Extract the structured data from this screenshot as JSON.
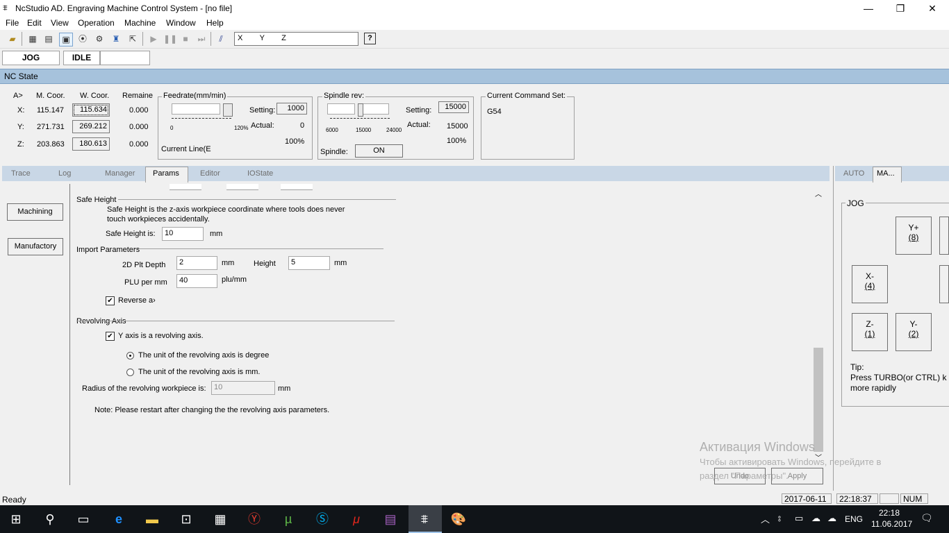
{
  "window": {
    "title": "NcStudio AD. Engraving Machine Control System  - [no file]",
    "minimize": "—",
    "maximize": "❐",
    "close": "✕"
  },
  "menu": [
    "File",
    "Edit",
    "View",
    "Operation",
    "Machine",
    "Window",
    "Help"
  ],
  "toolbar": {
    "command_text": "X        Y        Z",
    "help_icon": "?"
  },
  "status_boxes": {
    "mode": "JOG",
    "state": "IDLE"
  },
  "nc_state": {
    "label": "NC State"
  },
  "coords": {
    "headers": [
      "A>",
      "M. Coor.",
      "W. Coor.",
      "Remaine"
    ],
    "rows": [
      {
        "axis": "X:",
        "m": "115.147",
        "w": "115.634",
        "r": "0.000"
      },
      {
        "axis": "Y:",
        "m": "271.731",
        "w": "269.212",
        "r": "0.000"
      },
      {
        "axis": "Z:",
        "m": "203.863",
        "w": "180.613",
        "r": "0.000"
      }
    ]
  },
  "feedrate": {
    "label": "Feedrate(mm/min)",
    "setting_label": "Setting:",
    "setting": "1000",
    "actual_label": "Actual:",
    "actual": "0",
    "percent": "100%",
    "scale_min": "0",
    "scale_max": "120%",
    "current_line": "Current Line(E"
  },
  "spindle": {
    "label": "Spindle rev:",
    "setting_label": "Setting:",
    "setting": "15000",
    "actual_label": "Actual:",
    "actual": "15000",
    "percent": "100%",
    "ticks": [
      "6000",
      "15000",
      "24000"
    ],
    "spindle_label": "Spindle:",
    "on_button": "ON"
  },
  "command_set": {
    "label": "Current Command Set:",
    "value": "G54"
  },
  "tabs": [
    "Trace",
    "Log",
    "Manager",
    "Params",
    "Editor",
    "IOState"
  ],
  "active_tab": "Params",
  "side_buttons": {
    "machining": "Machining",
    "manufactory": "Manufactory"
  },
  "params": {
    "safe_height": {
      "section": "Safe Height",
      "desc1": "Safe Height is the z-axis workpiece coordinate where tools does never",
      "desc2": "touch workpieces accidentally.",
      "label": "Safe Height is:",
      "value": "10",
      "unit": "mm"
    },
    "import": {
      "section": "Import Parameters",
      "depth_label": "2D Plt Depth",
      "depth": "2",
      "depth_unit": "mm",
      "height_label": "Height",
      "height": "5",
      "height_unit": "mm",
      "plu_label": "PLU per mm",
      "plu": "40",
      "plu_unit": "plu/mm",
      "reverse_label": "Reverse a›"
    },
    "revolving": {
      "section": "Revolving Axis",
      "y_label": "Y axis is a revolving axis.",
      "deg_label": "The unit of the revolving axis is degree",
      "mm_label": "The unit of the revolving axis is mm.",
      "radius_label": "Radius of the revolving workpiece is:",
      "radius": "10",
      "radius_unit": "mm",
      "note": "Note: Please restart after changing the the revolving axis parameters."
    },
    "undo": "Undo",
    "apply": "Apply"
  },
  "right_tabs": [
    "AUTO",
    "MA..."
  ],
  "jog": {
    "label": "JOG",
    "yplus": "Y+",
    "yplus_key": "(8)",
    "xminus": "X-",
    "xminus_key": "(4)",
    "zminus": "Z-",
    "zminus_key": "(1)",
    "yminus": "Y-",
    "yminus_key": "(2)",
    "tip_label": "Tip:",
    "tip1": "Press TURBO(or CTRL) k",
    "tip2": "more rapidly"
  },
  "watermark": {
    "line1": "Активация Windows",
    "line2": "Чтобы активировать Windows, перейдите в",
    "line3": "раздел \"Параметры\"."
  },
  "statusbar": {
    "ready": "Ready",
    "date": "2017-06-11",
    "time": "22:18:37",
    "num": "NUM"
  },
  "taskbar": {
    "lang": "ENG",
    "clock": "22:18",
    "date": "11.06.2017"
  }
}
